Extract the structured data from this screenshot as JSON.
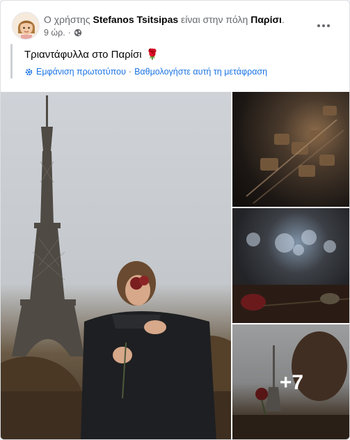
{
  "post": {
    "prefix": "Ο χρήστης ",
    "author": "Stefanos Tsitsipas",
    "middle": " είναι στην πόλη ",
    "place": "Παρίσι",
    "suffix": ".",
    "time": "9 ώρ.",
    "dot": "·",
    "text": "Τριαντάφυλλα στο Παρίσι",
    "emoji": "🌹",
    "show_original": "Εμφάνιση πρωτοτύπου",
    "separator": "·",
    "rate_translation": "Βαθμολογήστε αυτή τη μετάφραση"
  },
  "photos": {
    "more_count": "+7"
  },
  "icons": {
    "privacy": "globe-icon",
    "menu": "more-options-icon",
    "translation": "gear-icon"
  },
  "colors": {
    "link": "#1b74e4",
    "secondary_text": "#65676b"
  }
}
